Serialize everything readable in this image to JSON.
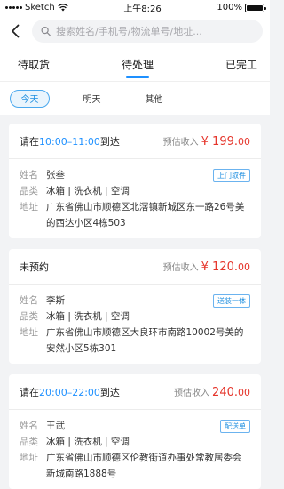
{
  "status_bar": {
    "carrier": "Sketch",
    "time": "上午8:26",
    "battery": "100%"
  },
  "search": {
    "placeholder": "搜索姓名/手机号/物流单号/地址..."
  },
  "tabs": [
    {
      "label": "待取货",
      "active": false
    },
    {
      "label": "待处理",
      "active": true
    },
    {
      "label": "已完工",
      "active": false
    }
  ],
  "chips": [
    {
      "label": "今天",
      "active": true
    },
    {
      "label": "明天",
      "active": false
    },
    {
      "label": "其他",
      "active": false
    }
  ],
  "labels": {
    "name": "姓名",
    "category": "品类",
    "address": "地址",
    "income": "预估收入"
  },
  "orders": [
    {
      "title_prefix": "请在",
      "time": "10:00–11:00",
      "title_suffix": "到达",
      "price_main": "¥ 199.",
      "price_dec": "00",
      "tag": "上门取件",
      "name": "张叁",
      "category": "冰箱 | 洗衣机 | 空调",
      "address": "广东省佛山市顺德区北滘镇新城区东一路26号美的西达小区4栋503"
    },
    {
      "title_prefix": "未预约",
      "time": "",
      "title_suffix": "",
      "price_main": "¥ 120.",
      "price_dec": "00",
      "tag": "送装一体",
      "name": "李斯",
      "category": "冰箱 | 洗衣机 | 空调",
      "address": "广东省佛山市顺德区大良环市南路10002号美的安然小区5栋301"
    },
    {
      "title_prefix": "请在",
      "time": "20:00–22:00",
      "title_suffix": "到达",
      "price_main": "240.",
      "price_dec": "00",
      "tag": "配送单",
      "name": "王武",
      "category": "冰箱 | 洗衣机 | 空调",
      "address": "广东省佛山市顺德区伦教街道办事处常教居委会新城南路1888号"
    }
  ],
  "colors": {
    "accent": "#1e90ff",
    "price": "#e5342a",
    "background": "#f2f3f5"
  }
}
